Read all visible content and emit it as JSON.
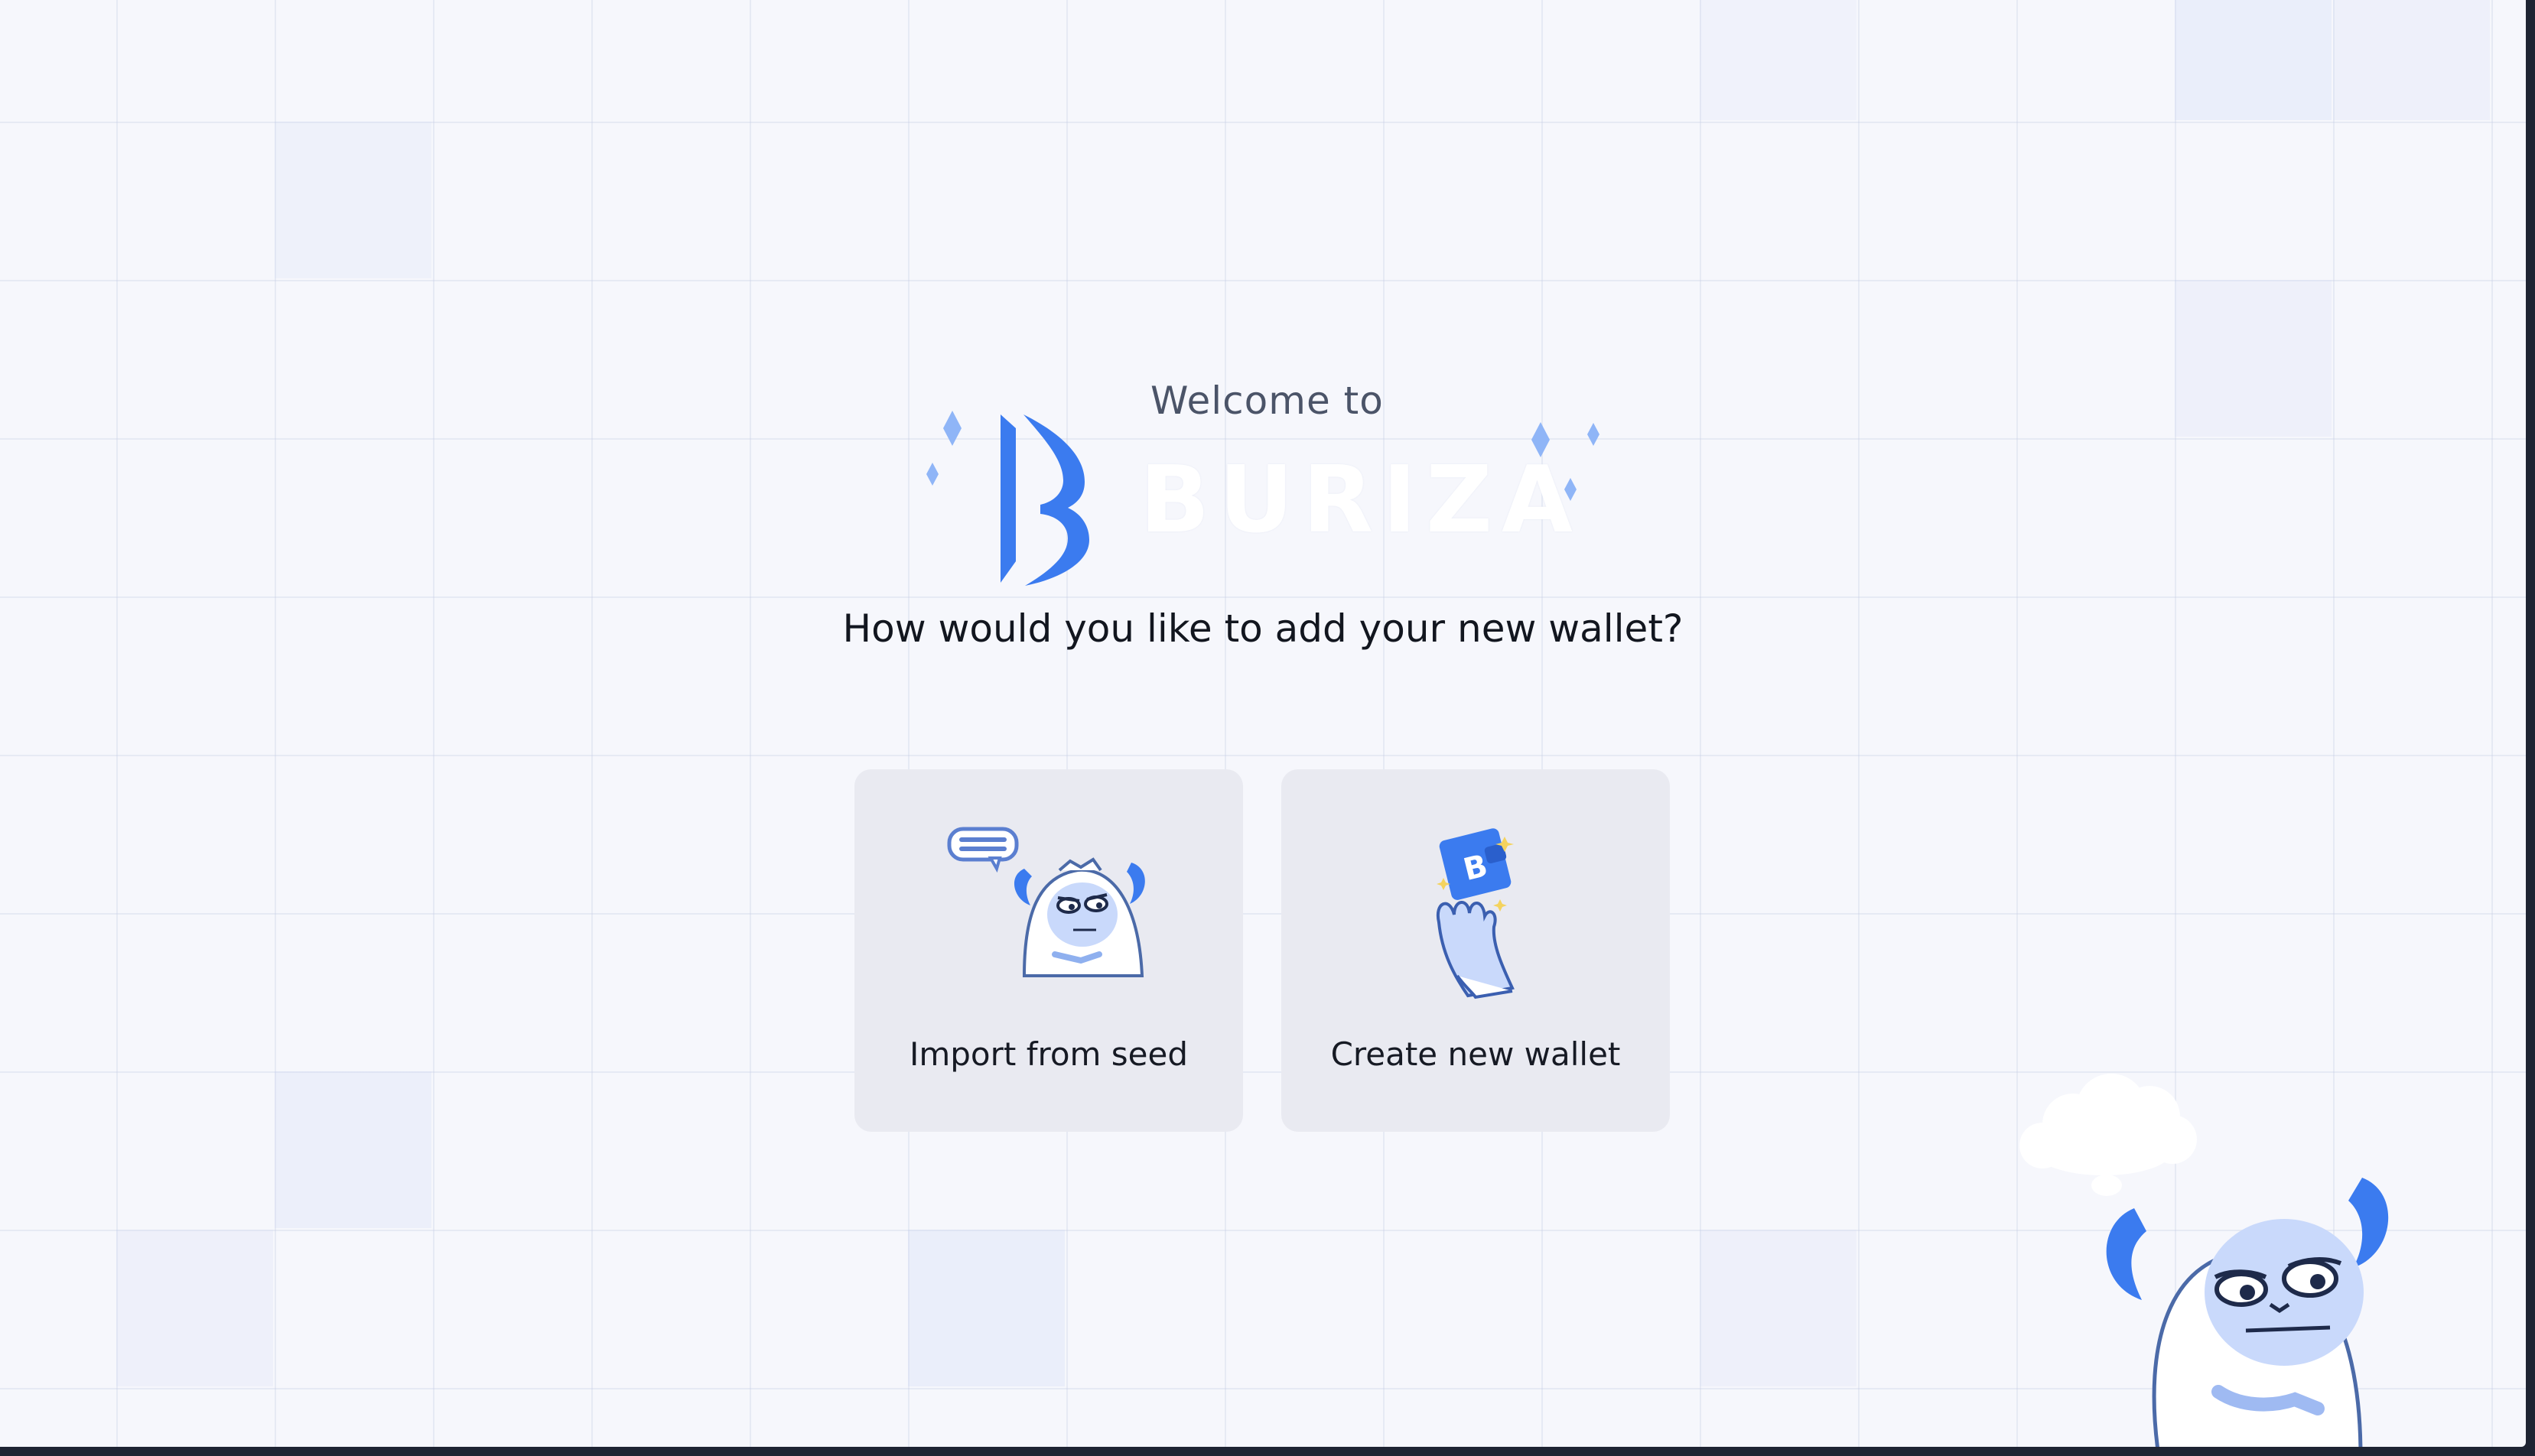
{
  "header": {
    "welcome_text": "Welcome to",
    "brand_name": "BURIZA"
  },
  "main": {
    "question": "How would you like to add your new wallet?",
    "options": [
      {
        "label": "Import from seed",
        "icon": "yeti-speech-bubble-icon"
      },
      {
        "label": "Create new wallet",
        "icon": "hand-holding-wallet-icon"
      }
    ]
  },
  "colors": {
    "background": "#f6f7fc",
    "brand_blue": "#3b7bef",
    "card_bg": "#e9eaf1",
    "text_dark": "#12161f",
    "text_muted": "#4b5468"
  }
}
